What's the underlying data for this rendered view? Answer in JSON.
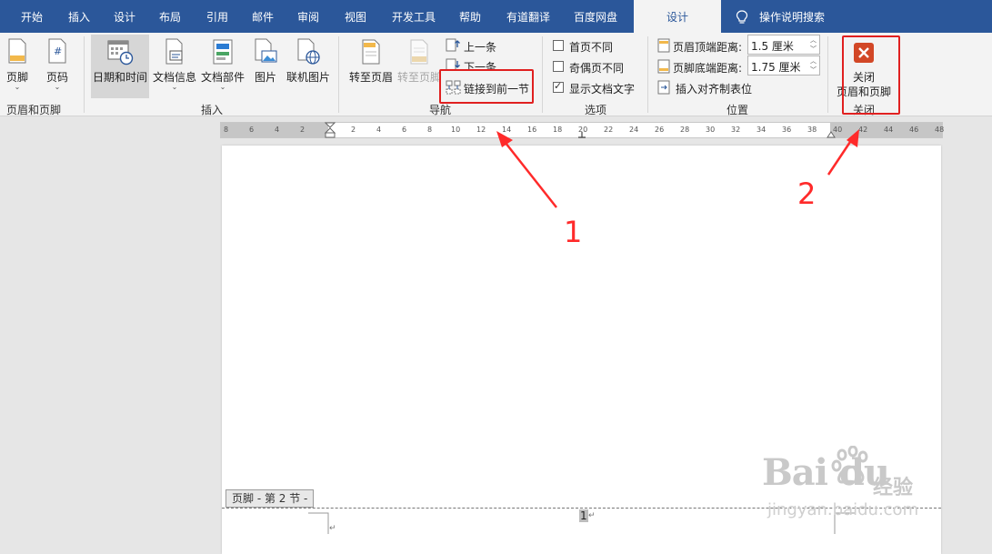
{
  "tabs": [
    {
      "label": "开始"
    },
    {
      "label": "插入"
    },
    {
      "label": "设计"
    },
    {
      "label": "布局"
    },
    {
      "label": "引用"
    },
    {
      "label": "邮件"
    },
    {
      "label": "审阅"
    },
    {
      "label": "视图"
    },
    {
      "label": "开发工具"
    },
    {
      "label": "帮助"
    },
    {
      "label": "有道翻译"
    },
    {
      "label": "百度网盘"
    },
    {
      "label": "设计"
    }
  ],
  "tell_me": "操作说明搜索",
  "ribbon": {
    "header_footer_group": {
      "footer": "页脚",
      "page_number": "页码",
      "label": "页眉和页脚"
    },
    "insert_group": {
      "date_time": "日期和时间",
      "doc_info": "文档信息",
      "doc_parts": "文档部件",
      "picture": "图片",
      "online_picture": "联机图片",
      "label": "插入"
    },
    "nav_group": {
      "goto_header": "转至页眉",
      "goto_footer": "转至页脚",
      "previous": "上一条",
      "next": "下一条",
      "link_previous": "链接到前一节",
      "label": "导航"
    },
    "options_group": {
      "diff_first": "首页不同",
      "diff_odd_even": "奇偶页不同",
      "show_doc_text": "显示文档文字",
      "label": "选项"
    },
    "position_group": {
      "header_top_label": "页眉顶端距离:",
      "header_top_value": "1.5 厘米",
      "footer_bottom_label": "页脚底端距离:",
      "footer_bottom_value": "1.75 厘米",
      "insert_align_tab": "插入对齐制表位",
      "label": "位置"
    },
    "close_group": {
      "close_line1": "关闭",
      "close_line2": "页眉和页脚",
      "label": "关闭"
    }
  },
  "ruler_ticks": [
    "8",
    "6",
    "4",
    "2",
    "2",
    "4",
    "6",
    "8",
    "10",
    "12",
    "14",
    "16",
    "18",
    "20",
    "22",
    "24",
    "26",
    "28",
    "30",
    "32",
    "34",
    "36",
    "38",
    "40",
    "42",
    "44",
    "46",
    "48"
  ],
  "document": {
    "footer_tag": "页脚 - 第 2 节 -",
    "page_number": "1"
  },
  "annotations": {
    "one": "1",
    "two": "2"
  },
  "colors": {
    "brand": "#2b579a",
    "highlight": "#e02020",
    "close_icon": "#d24726"
  }
}
